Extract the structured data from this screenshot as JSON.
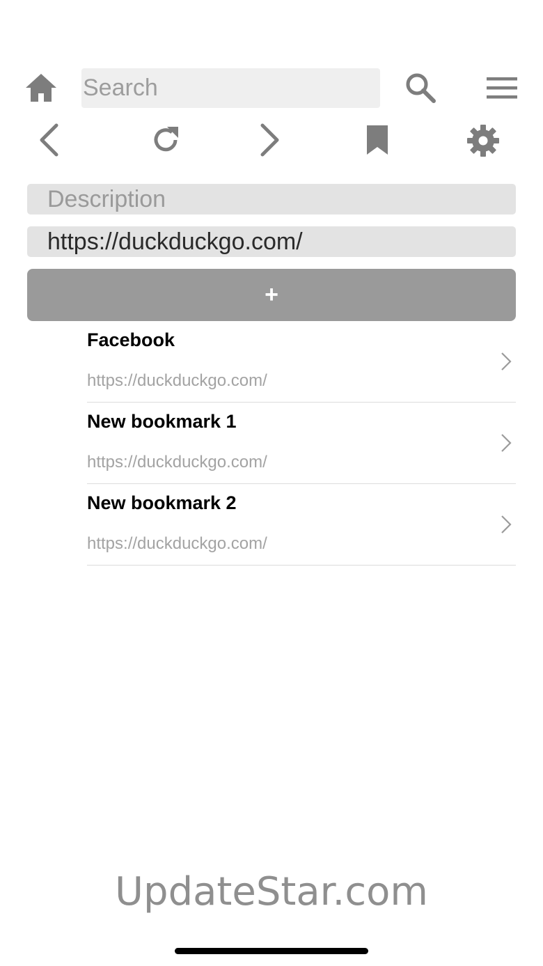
{
  "toolbar": {
    "search": {
      "placeholder": "Search",
      "value": ""
    },
    "icons": {
      "home": "home-icon",
      "search": "search-icon",
      "menu": "hamburger-menu-icon",
      "back": "chevron-left-icon",
      "reload": "reload-icon",
      "forward": "chevron-right-icon",
      "bookmark": "bookmark-icon",
      "settings": "gear-icon"
    },
    "icon_color": "#7d7d7d"
  },
  "form": {
    "description": {
      "placeholder": "Description",
      "value": ""
    },
    "url": {
      "placeholder": "",
      "value": "https://duckduckgo.com/"
    },
    "add_label": "+"
  },
  "bookmarks": [
    {
      "title": "Facebook",
      "url": "https://duckduckgo.com/"
    },
    {
      "title": "New bookmark 1",
      "url": "https://duckduckgo.com/"
    },
    {
      "title": "New bookmark 2",
      "url": "https://duckduckgo.com/"
    }
  ],
  "watermark": "UpdateStar.com",
  "colors": {
    "field_bg": "#e3e3e3",
    "button_bg": "#9a9a9a",
    "secondary_text": "#a3a3a3"
  }
}
